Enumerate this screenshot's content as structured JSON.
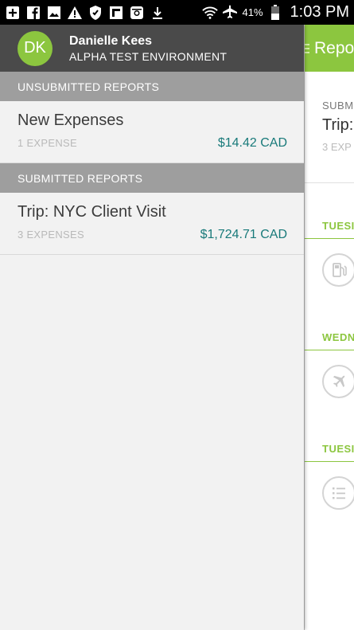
{
  "status_bar": {
    "icons": [
      "add-box-icon",
      "facebook-icon",
      "image-icon",
      "warning-icon",
      "shield-icon",
      "flipboard-icon",
      "instagram-icon",
      "download-icon",
      "wifi-icon",
      "airplane-icon"
    ],
    "battery": "41%",
    "time": "1:03 PM"
  },
  "user": {
    "initials": "DK",
    "name": "Danielle Kees",
    "environment": "ALPHA TEST ENVIRONMENT"
  },
  "sections": {
    "unsubmitted": {
      "header": "UNSUBMITTED REPORTS",
      "items": [
        {
          "title": "New Expenses",
          "count": "1 EXPENSE",
          "amount": "$14.42 CAD"
        }
      ]
    },
    "submitted": {
      "header": "SUBMITTED REPORTS",
      "items": [
        {
          "title": "Trip: NYC Client Visit",
          "count": "3 EXPENSES",
          "amount": "$1,724.71 CAD"
        }
      ]
    }
  },
  "background_screen": {
    "title": "Repo",
    "status_label": "SUBM",
    "report_title": "Trip:",
    "expense_count": "3 EXP",
    "days": [
      "TUESI",
      "WEDN",
      "TUESI"
    ],
    "item_icons": [
      "gas-pump-icon",
      "airplane-icon",
      "list-icon"
    ]
  },
  "colors": {
    "accent_green": "#8cc63f",
    "amount_teal": "#197a7a",
    "profile_bg": "#4a4a4a",
    "section_header_bg": "#9e9e9e"
  }
}
